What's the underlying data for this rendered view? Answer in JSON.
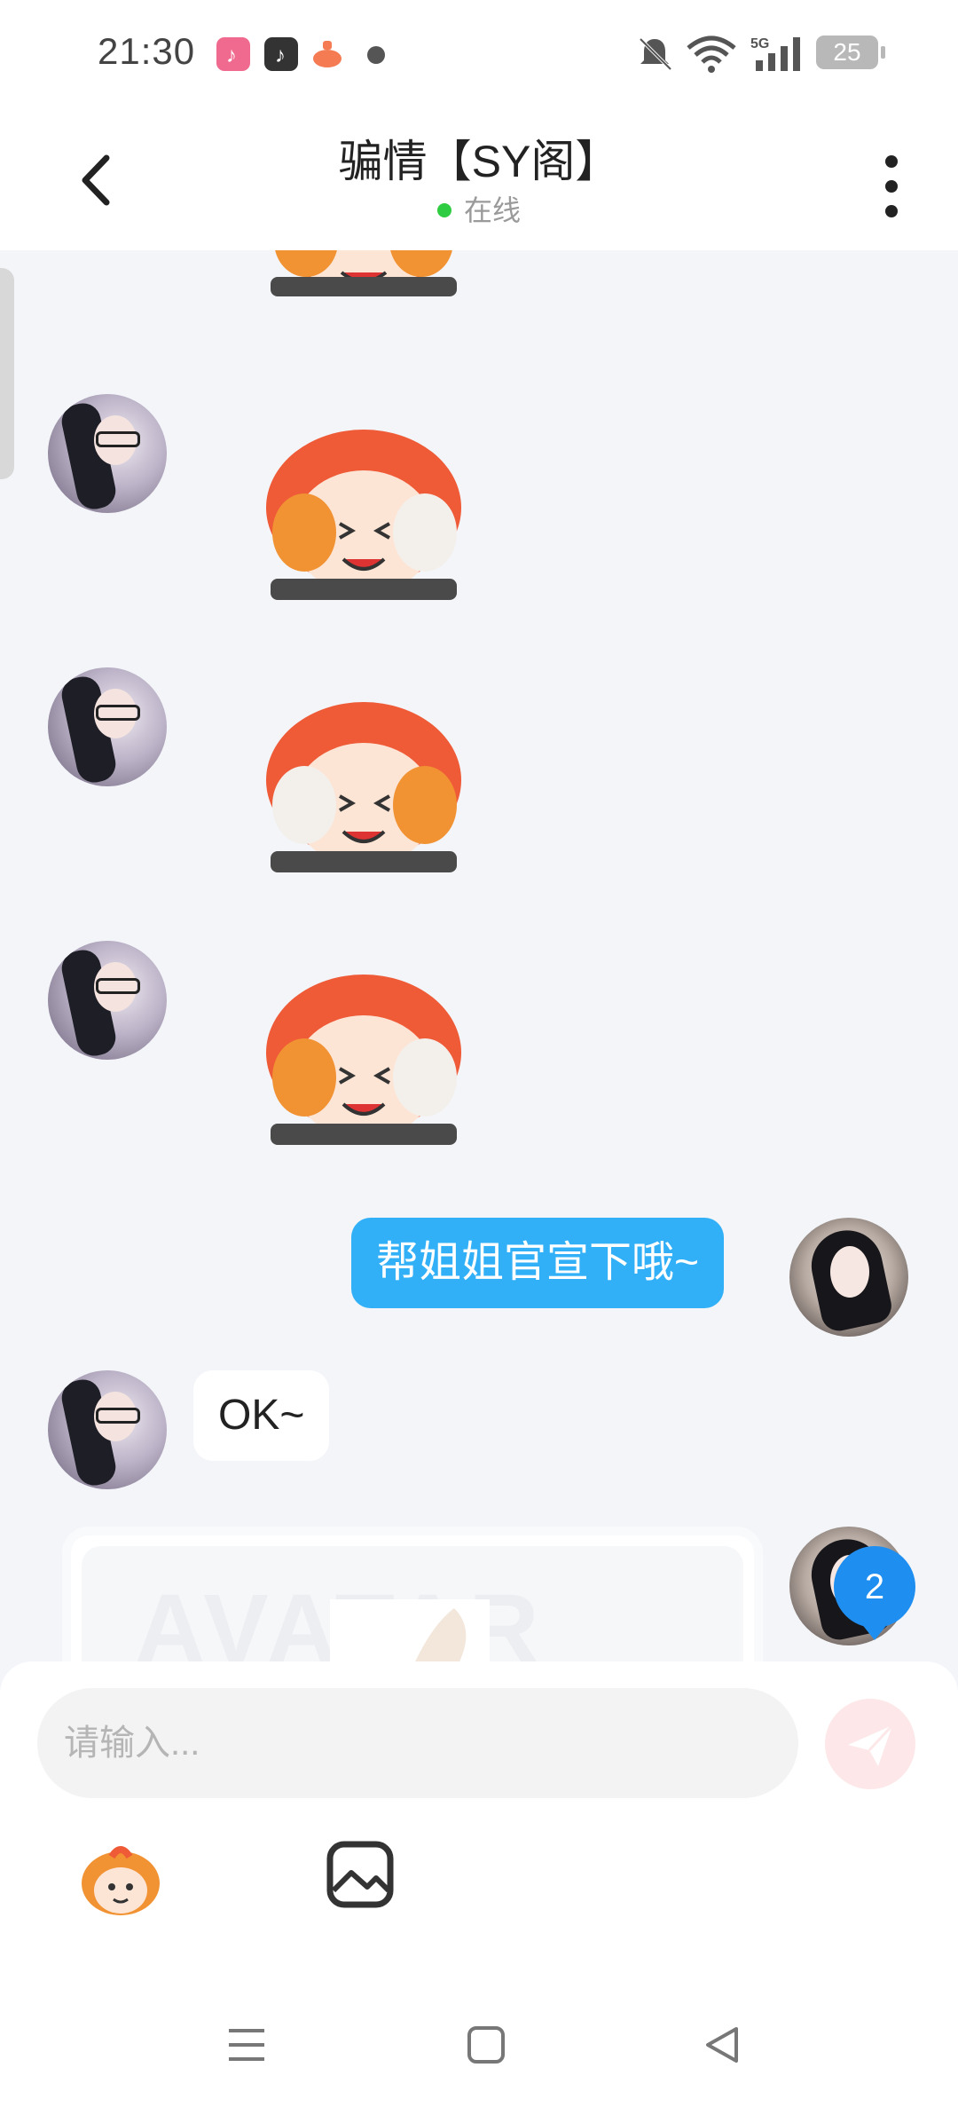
{
  "status_bar": {
    "time": "21:30",
    "battery": "25",
    "network": "5G"
  },
  "header": {
    "title": "骗情【SY阁】",
    "status": "在线",
    "status_color": "#2ecc40"
  },
  "messages": [
    {
      "from": "other",
      "type": "sticker"
    },
    {
      "from": "other",
      "type": "sticker"
    },
    {
      "from": "other",
      "type": "sticker"
    },
    {
      "from": "other",
      "type": "sticker"
    },
    {
      "from": "me",
      "type": "text",
      "text": "帮姐姐官宣下哦~"
    },
    {
      "from": "other",
      "type": "text",
      "text": "OK~"
    },
    {
      "from": "me",
      "type": "card",
      "watermark": "AVATAR"
    }
  ],
  "unread_badge": "2",
  "input": {
    "placeholder": "请输入..."
  },
  "colors": {
    "me_bubble": "#31b0f7",
    "badge": "#1e8ef0",
    "send_button": "#fde7e8"
  }
}
